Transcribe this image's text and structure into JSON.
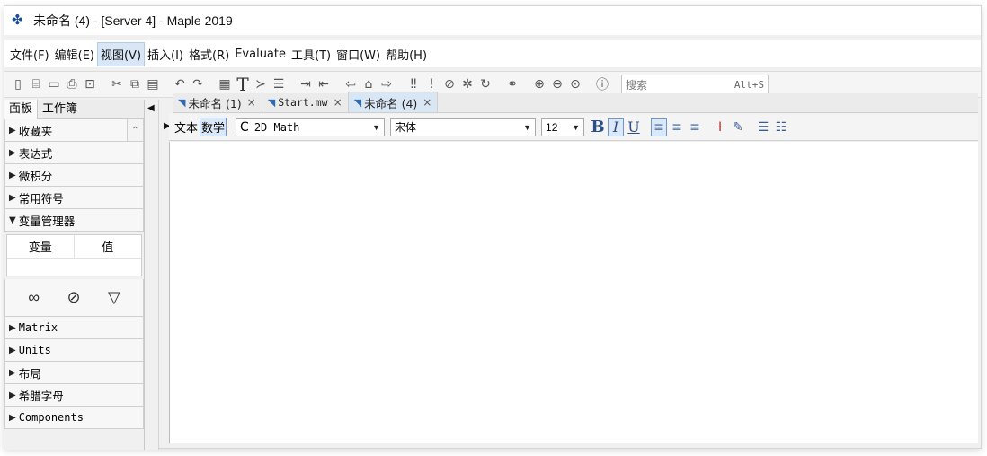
{
  "window": {
    "title": "未命名 (4) - [Server 4] - Maple 2019"
  },
  "menu": [
    {
      "label": "文件(F)",
      "active": false
    },
    {
      "label": "编辑(E)",
      "active": false
    },
    {
      "label": "视图(V)",
      "active": true
    },
    {
      "label": "插入(I)",
      "active": false
    },
    {
      "label": "格式(R)",
      "active": false
    },
    {
      "label": "Evaluate",
      "active": false
    },
    {
      "label": "工具(T)",
      "active": false
    },
    {
      "label": "窗口(W)",
      "active": false
    },
    {
      "label": "帮助(H)",
      "active": false
    }
  ],
  "toolbar": {
    "search_placeholder": "搜索",
    "search_hint": "Alt+S"
  },
  "left_panel": {
    "tabs": [
      "面板",
      "工作簿"
    ],
    "palettes_top": [
      {
        "label": "收藏夹",
        "expanded": false
      },
      {
        "label": "表达式",
        "expanded": false
      },
      {
        "label": "微积分",
        "expanded": false
      },
      {
        "label": "常用符号",
        "expanded": false
      },
      {
        "label": "变量管理器",
        "expanded": true
      }
    ],
    "var_table": {
      "col1": "变量",
      "col2": "值"
    },
    "palettes_bottom": [
      {
        "label": "Matrix",
        "mono": true
      },
      {
        "label": "Units",
        "mono": true
      },
      {
        "label": "布局",
        "mono": false
      },
      {
        "label": "希腊字母",
        "mono": false
      },
      {
        "label": "Components",
        "mono": true
      }
    ]
  },
  "doc_tabs": [
    {
      "label": "未命名 (1)",
      "active": false
    },
    {
      "label": "Start.mw",
      "active": false
    },
    {
      "label": "未命名 (4)",
      "active": true
    }
  ],
  "format_bar": {
    "text_mode": "文本",
    "math_mode": "数学",
    "input_mode": "2D Math",
    "font": "宋体",
    "size": "12",
    "bold": "B",
    "italic": "I",
    "underline": "U"
  },
  "colors": {
    "accent": "#dce8f6",
    "accent_border": "#6e96c8",
    "icon_blue": "#2b4f86"
  }
}
